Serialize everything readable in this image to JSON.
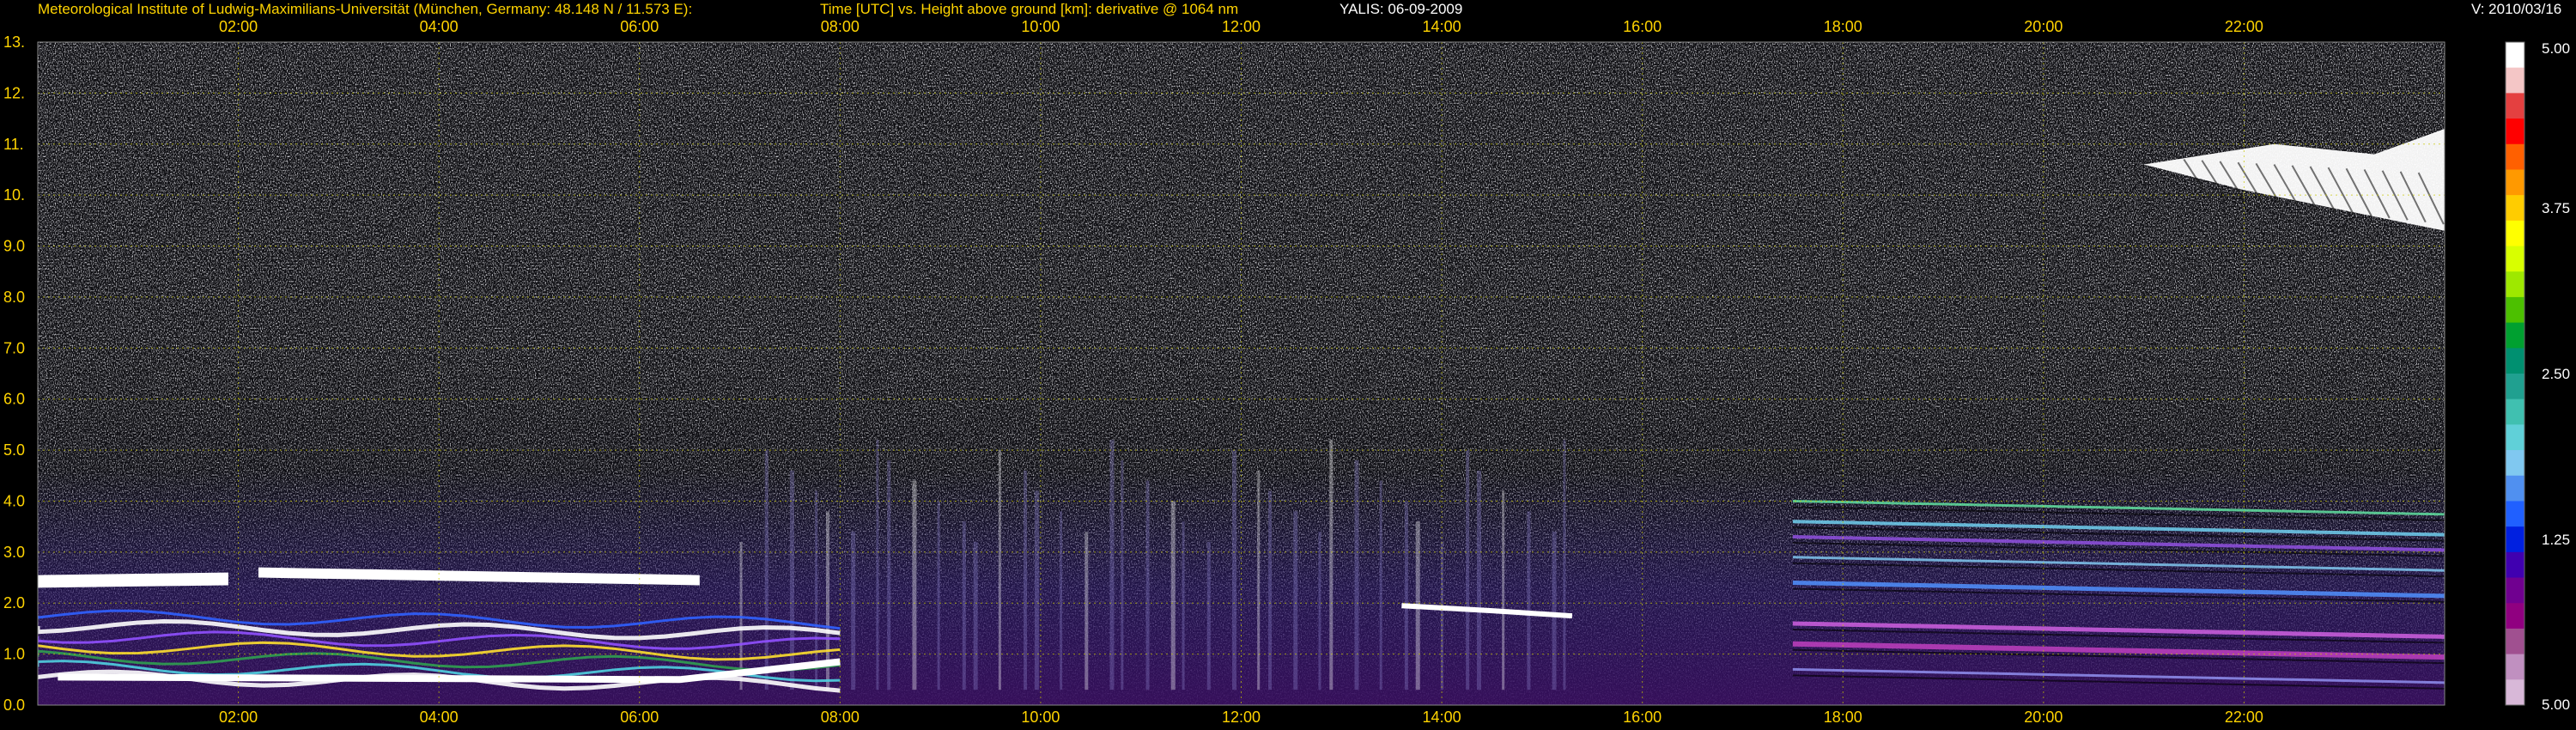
{
  "header": {
    "institute": "Meteorological Institute of Ludwig-Maximilians-Universität (München, Germany: 48.148 N / 11.573 E):",
    "title": "Time [UTC] vs. Height above ground [km]: derivative @ 1064 nm",
    "instrument_date": "YALIS: 06-09-2009",
    "version": "V: 2010/03/16"
  },
  "chart_data": {
    "type": "heatmap",
    "title": "Time [UTC] vs. Height above ground [km]: derivative @ 1064 nm",
    "xlabel": "Time [UTC]",
    "ylabel": "Height above ground [km]",
    "x_range_hours": [
      0.0,
      24.0
    ],
    "y_range_km": [
      0.0,
      13.0
    ],
    "x_ticks": [
      "02:00",
      "04:00",
      "06:00",
      "08:00",
      "10:00",
      "12:00",
      "14:00",
      "16:00",
      "18:00",
      "20:00",
      "22:00"
    ],
    "x_tick_values_hours": [
      2,
      4,
      6,
      8,
      10,
      12,
      14,
      16,
      18,
      20,
      22
    ],
    "y_ticks": [
      "0.0",
      "1.0",
      "2.0",
      "3.0",
      "4.0",
      "5.0",
      "6.0",
      "7.0",
      "8.0",
      "9.0",
      "10.",
      "11.",
      "12.",
      "13."
    ],
    "y_tick_values_km": [
      0,
      1,
      2,
      3,
      4,
      5,
      6,
      7,
      8,
      9,
      10,
      11,
      12,
      13
    ],
    "grid": true,
    "grid_color": "#c8c800",
    "colorbar": {
      "labels": [
        "5.00",
        "3.75",
        "2.50",
        "1.25",
        "5.00"
      ],
      "colors_top_to_bottom": [
        "#ffffff",
        "#f4c6c6",
        "#e44040",
        "#ff0000",
        "#ff6000",
        "#ff9900",
        "#ffcc00",
        "#ffff00",
        "#d8ff00",
        "#9ee800",
        "#4cc000",
        "#00a030",
        "#009070",
        "#20a090",
        "#40c0b0",
        "#60d0d8",
        "#80c8f0",
        "#5090f0",
        "#2060ff",
        "#0020e0",
        "#4000b0",
        "#700090",
        "#900080",
        "#a05090",
        "#c090c0",
        "#d8b8d8"
      ]
    },
    "features": [
      {
        "name": "boundary layer top (white)",
        "t_start": 0.0,
        "t_end": 6.7,
        "height_km": 2.5
      },
      {
        "name": "low aerosol layers (multicolor)",
        "t_start": 0.0,
        "t_end": 8.0,
        "height_km": 0.9
      },
      {
        "name": "convective plumes",
        "t_start": 7.0,
        "t_end": 15.5,
        "height_km": 2.5
      },
      {
        "name": "midday layer (white)",
        "t_start": 13.5,
        "t_end": 15.4,
        "height_km": 1.9
      },
      {
        "name": "residual layers (purple/cyan)",
        "t_start": 17.5,
        "t_end": 24.0,
        "height_km": 3.6
      },
      {
        "name": "residual layer (cyan)",
        "t_start": 17.5,
        "t_end": 24.0,
        "height_km": 2.3
      },
      {
        "name": "cirrus cloud (white)",
        "t_start": 21.0,
        "t_end": 24.0,
        "height_km": 10.2
      }
    ]
  }
}
